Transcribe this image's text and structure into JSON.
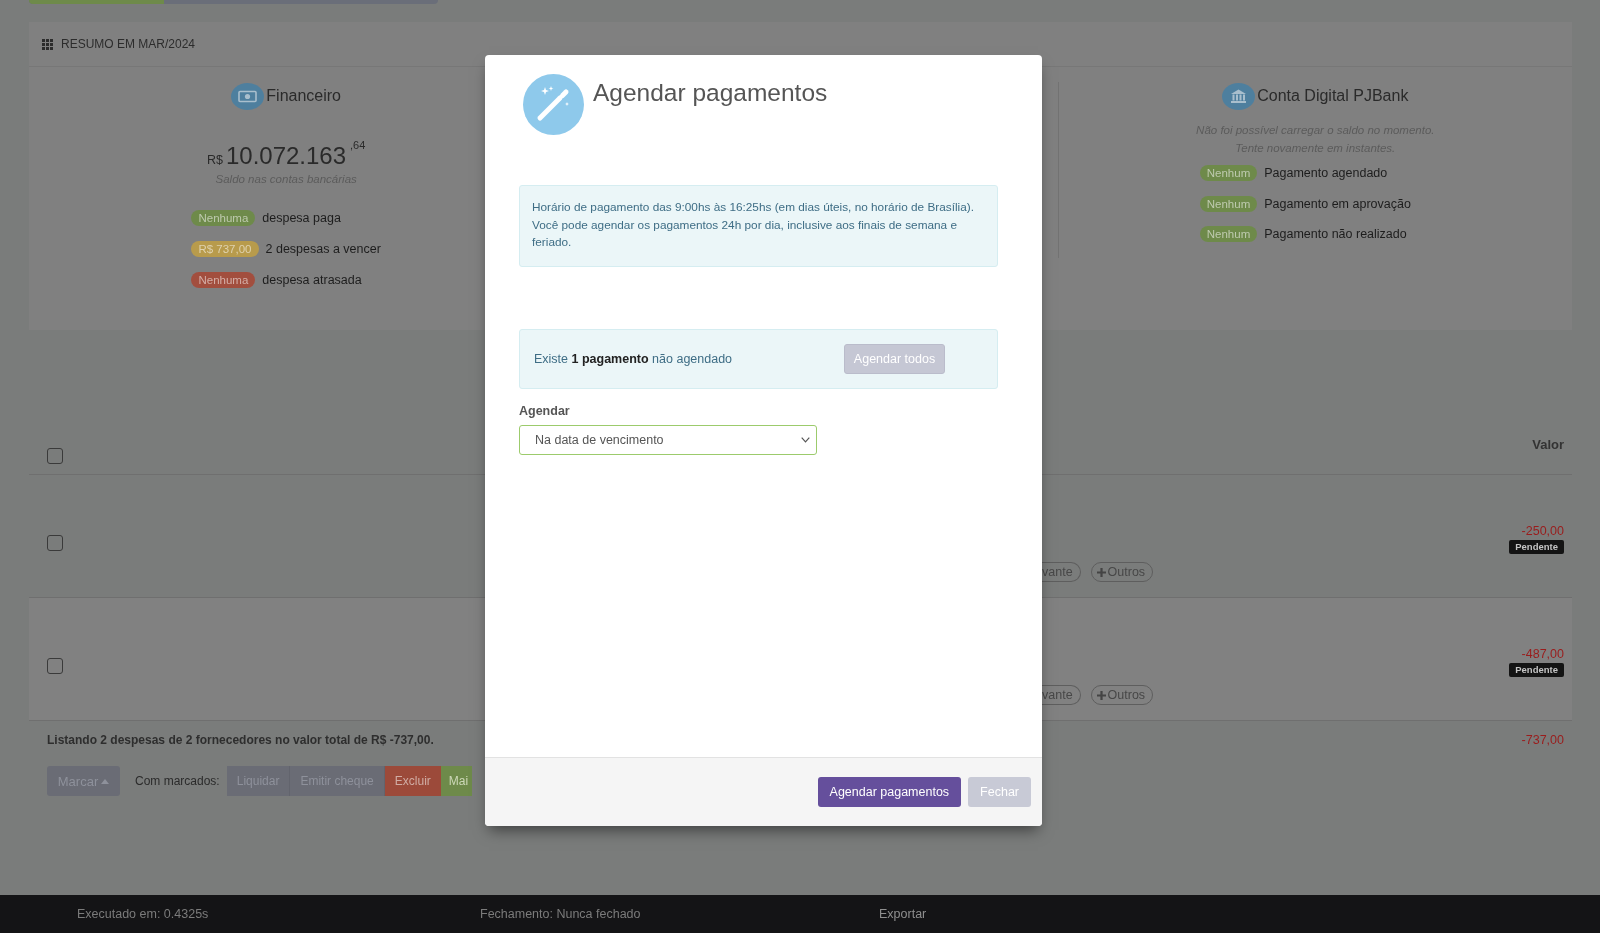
{
  "progress": {
    "level": 0.33
  },
  "summary": {
    "title": "RESUMO EM MAR/2024",
    "finance": {
      "title": "Financeiro",
      "currency": "R$",
      "amount": "10.072.163",
      "cents": ",64",
      "caption": "Saldo nas contas bancárias",
      "items": [
        {
          "badge": "Nenhuma",
          "color": "#6e8a4a",
          "label": "despesa paga"
        },
        {
          "badge": "R$ 737,00",
          "color": "#b89b4c",
          "label": "2 despesas a vencer"
        },
        {
          "badge": "Nenhuma",
          "color": "#a24e3e",
          "label": "despesa atrasada"
        }
      ]
    },
    "bank": {
      "title": "Conta Digital PJBank",
      "message": [
        "Não foi possível carregar o saldo no momento.",
        "Tente novamente em instantes."
      ],
      "items": [
        {
          "badge": "Nenhum",
          "color": "#6e8a4a",
          "label": "Pagamento agendado"
        },
        {
          "badge": "Nenhum",
          "color": "#6e8a4a",
          "label": "Pagamento em aprovação"
        },
        {
          "badge": "Nenhum",
          "color": "#6e8a4a",
          "label": "Pagamento não realizado"
        }
      ]
    }
  },
  "table": {
    "select_all_checked": false,
    "value_column": "Valor",
    "rows": [
      {
        "checked": false,
        "value": "-250,00",
        "status": "Pendente",
        "actions": [
          {
            "kind": "partial",
            "label": "vante"
          },
          {
            "kind": "add",
            "label": "Outros"
          }
        ]
      },
      {
        "checked": false,
        "value": "-487,00",
        "status": "Pendente",
        "actions": [
          {
            "kind": "partial",
            "label": "vante"
          },
          {
            "kind": "add",
            "label": "Outros"
          }
        ]
      }
    ],
    "summary": "Listando 2 despesas de 2 fornecedores no valor total de R$ -737,00.",
    "total": "-737,00"
  },
  "bulk": {
    "menu": "Marcar",
    "label": "Com marcados:",
    "buttons": [
      {
        "kind": "default",
        "label": "Liquidar"
      },
      {
        "kind": "default",
        "label": "Emitir cheque"
      },
      {
        "kind": "danger",
        "label": "Excluir"
      },
      {
        "kind": "success",
        "label": "Mai"
      }
    ]
  },
  "footer": [
    {
      "kind": "text",
      "label": "Executado em: 0.4325s"
    },
    {
      "kind": "text",
      "label": "Fechamento: Nunca fechado"
    },
    {
      "kind": "link",
      "label": "Exportar"
    }
  ],
  "modal": {
    "title": "Agendar pagamentos",
    "notice": [
      "Horário de pagamento das 9:00hs às 16:25hs (em dias úteis, no horário de Brasília).",
      "Você pode agendar os pagamentos 24h por dia, inclusive aos finais de semana e feriado."
    ],
    "pending": "Existe **1 pagamento** não agendado",
    "schedule_all": {
      "label": "Agendar todos",
      "disabled": true
    },
    "field": {
      "label": "Agendar",
      "value": "Na data de vencimento"
    },
    "buttons": [
      {
        "kind": "primary",
        "label": "Agendar pagamentos"
      },
      {
        "kind": "secondary",
        "label": "Fechar"
      }
    ]
  }
}
